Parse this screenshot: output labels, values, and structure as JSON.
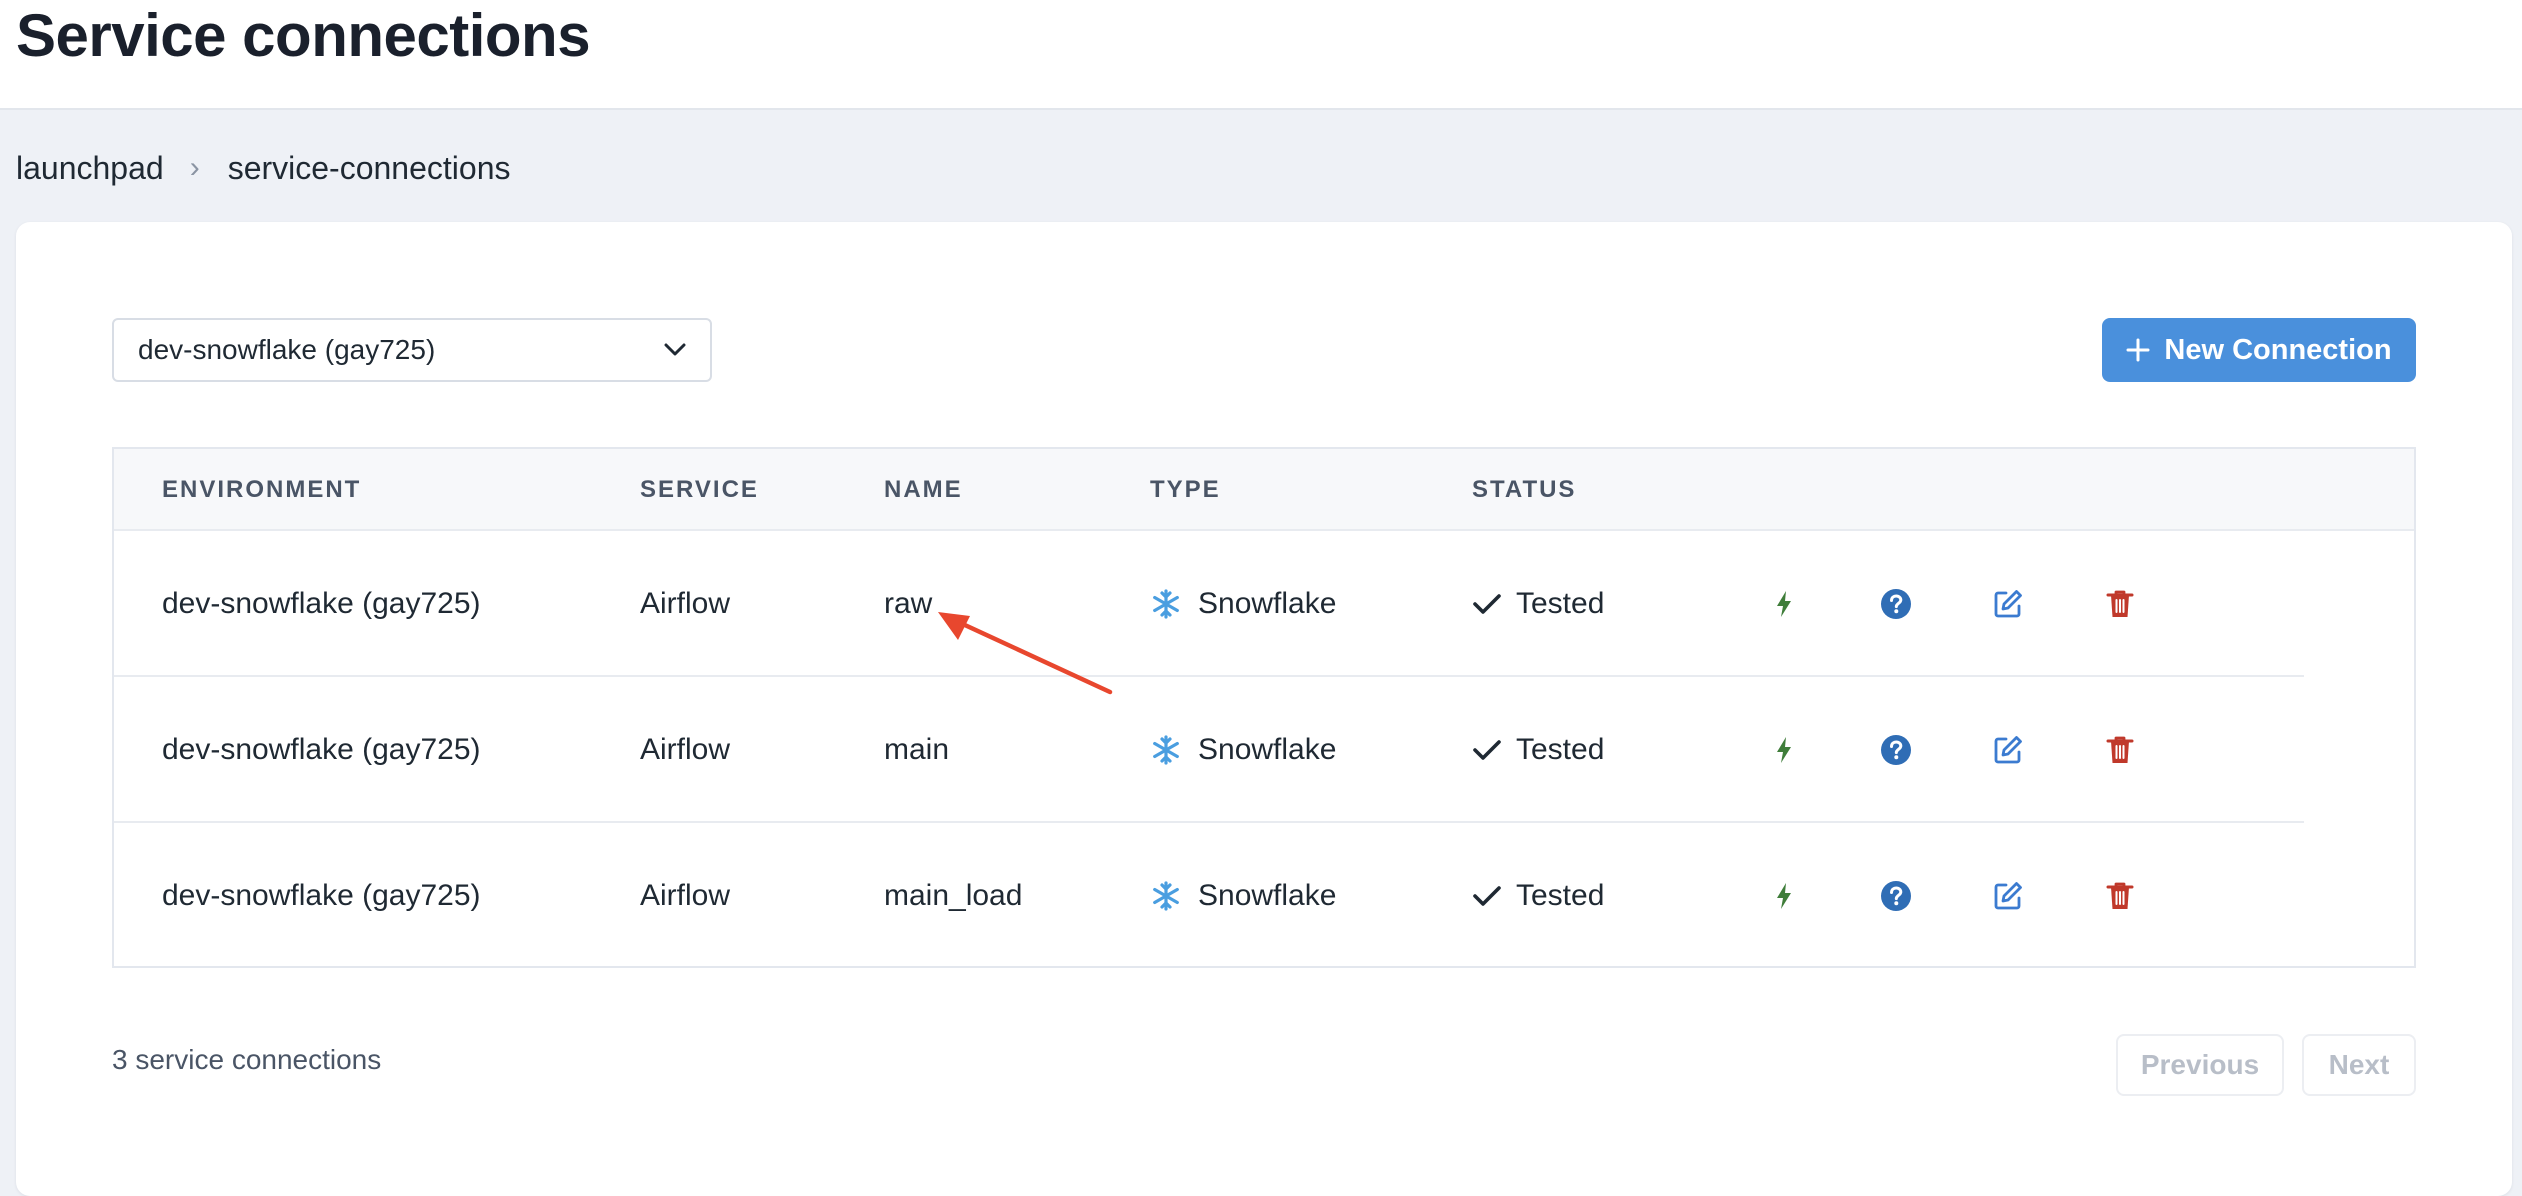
{
  "header": {
    "title": "Service connections"
  },
  "breadcrumb": {
    "items": [
      "launchpad",
      "service-connections"
    ],
    "separator": "›"
  },
  "environment_select": {
    "value": "dev-snowflake (gay725)"
  },
  "new_button": {
    "label": "New Connection"
  },
  "table": {
    "columns": [
      "ENVIRONMENT",
      "SERVICE",
      "NAME",
      "TYPE",
      "STATUS"
    ],
    "rows": [
      {
        "environment": "dev-snowflake (gay725)",
        "service": "Airflow",
        "name": "raw",
        "type": "Snowflake",
        "status": "Tested"
      },
      {
        "environment": "dev-snowflake (gay725)",
        "service": "Airflow",
        "name": "main",
        "type": "Snowflake",
        "status": "Tested"
      },
      {
        "environment": "dev-snowflake (gay725)",
        "service": "Airflow",
        "name": "main_load",
        "type": "Snowflake",
        "status": "Tested"
      }
    ],
    "row_actions": [
      "bolt-icon",
      "help-circle-icon",
      "edit-icon",
      "trash-icon"
    ]
  },
  "footer": {
    "count_text": "3 service connections",
    "previous_label": "Previous",
    "next_label": "Next"
  },
  "colors": {
    "primary": "#4a90dc",
    "bolt": "#3f7d3a",
    "help": "#2f6db5",
    "edit": "#3b7bd0",
    "delete": "#c0392b",
    "annotation_arrow": "#e8472e",
    "snowflake": "#4a9ee0"
  }
}
